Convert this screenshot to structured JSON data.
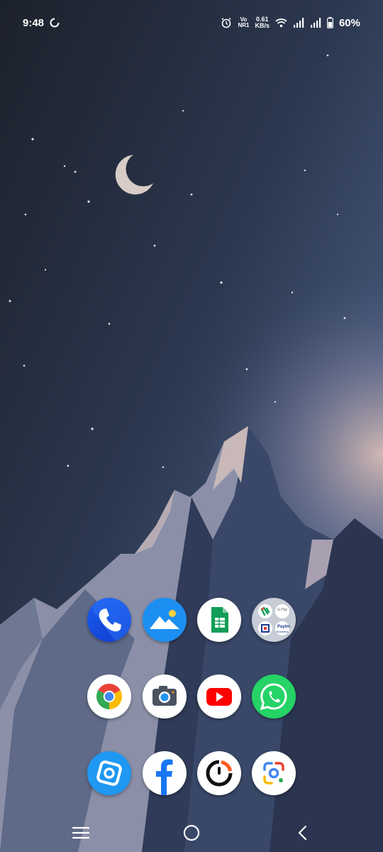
{
  "status_bar": {
    "time": "9:48",
    "network_type_top": "Vo",
    "network_type_bottom": "NR1",
    "speed_value": "0.61",
    "speed_unit": "KB/s",
    "battery": "60%",
    "icons": [
      "sync-icon",
      "alarm-icon",
      "wifi-icon",
      "signal-icon",
      "battery-icon"
    ]
  },
  "home": {
    "apps": [
      {
        "name": "phone-app",
        "icon": "phone-icon"
      },
      {
        "name": "gallery-app",
        "icon": "gallery-icon"
      },
      {
        "name": "sheets-app",
        "icon": "sheets-icon"
      },
      {
        "name": "payments-folder",
        "icon": "folder-icon",
        "labels": [
          "G Pay",
          "Paytm",
          "Business"
        ]
      },
      {
        "name": "chrome-app",
        "icon": "chrome-icon"
      },
      {
        "name": "camera-app",
        "icon": "camera-icon"
      },
      {
        "name": "youtube-app",
        "icon": "youtube-icon"
      },
      {
        "name": "whatsapp-app",
        "icon": "whatsapp-icon"
      },
      {
        "name": "app-store-app",
        "icon": "app-store-icon"
      },
      {
        "name": "facebook-app",
        "icon": "facebook-icon"
      },
      {
        "name": "fitness-app",
        "icon": "fitness-icon"
      },
      {
        "name": "lens-app",
        "icon": "lens-icon"
      }
    ]
  },
  "nav_bar": {
    "buttons": [
      "menu-icon",
      "home-icon",
      "back-icon"
    ]
  }
}
